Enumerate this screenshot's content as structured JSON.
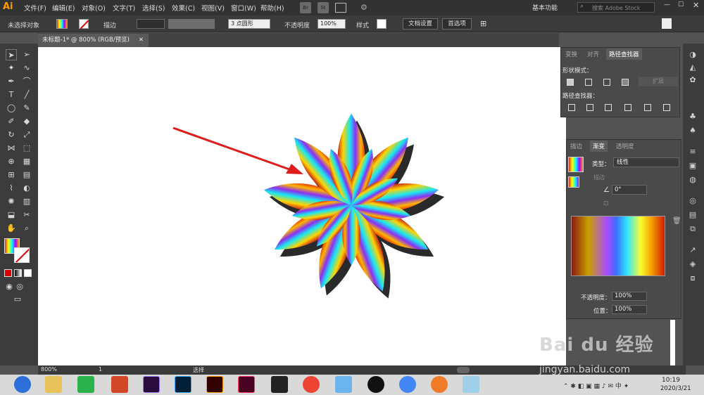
{
  "app": {
    "logo": "Ai",
    "workspace": "基本功能",
    "search_placeholder": "搜索 Adobe Stock"
  },
  "menu": [
    "文件(F)",
    "编辑(E)",
    "对象(O)",
    "文字(T)",
    "选择(S)",
    "效果(C)",
    "视图(V)",
    "窗口(W)",
    "帮助(H)"
  ],
  "bridge": [
    "Br",
    "St"
  ],
  "control": {
    "no_selection": "未选择对象",
    "stroke_label": "描边",
    "stroke_value": "3 点圆形",
    "opacity_label": "不透明度",
    "opacity_value": "100%",
    "style_label": "样式",
    "doc_setup": "文档设置",
    "preferences": "首选项"
  },
  "doc_tab": "未标题-1* @ 800% (RGB/预览)",
  "panel_pathfinder": {
    "tabs": [
      "变换",
      "对齐",
      "路径查找器"
    ],
    "shape_modes": "形状模式：",
    "expand": "扩展",
    "pathfinders": "路径查找器："
  },
  "panel_gradient": {
    "tabs": [
      "描边",
      "渐变",
      "透明度"
    ],
    "type_label": "类型：",
    "type_value": "线性",
    "stroke_label": "描边",
    "angle_value": "0°",
    "opacity_label": "不透明度：",
    "opacity_value": "100%",
    "location_label": "位置：",
    "location_value": "100%"
  },
  "status": {
    "zoom": "800%",
    "artboard": "1",
    "mode": "选择"
  },
  "clock": {
    "time": "10:19",
    "date": "2020/3/21"
  },
  "watermark": {
    "brand": "Bai du 经验",
    "url": "jingyan.baidu.com"
  },
  "colors": {
    "accent": "#ff9a00",
    "arrow": "#e01c1c"
  }
}
